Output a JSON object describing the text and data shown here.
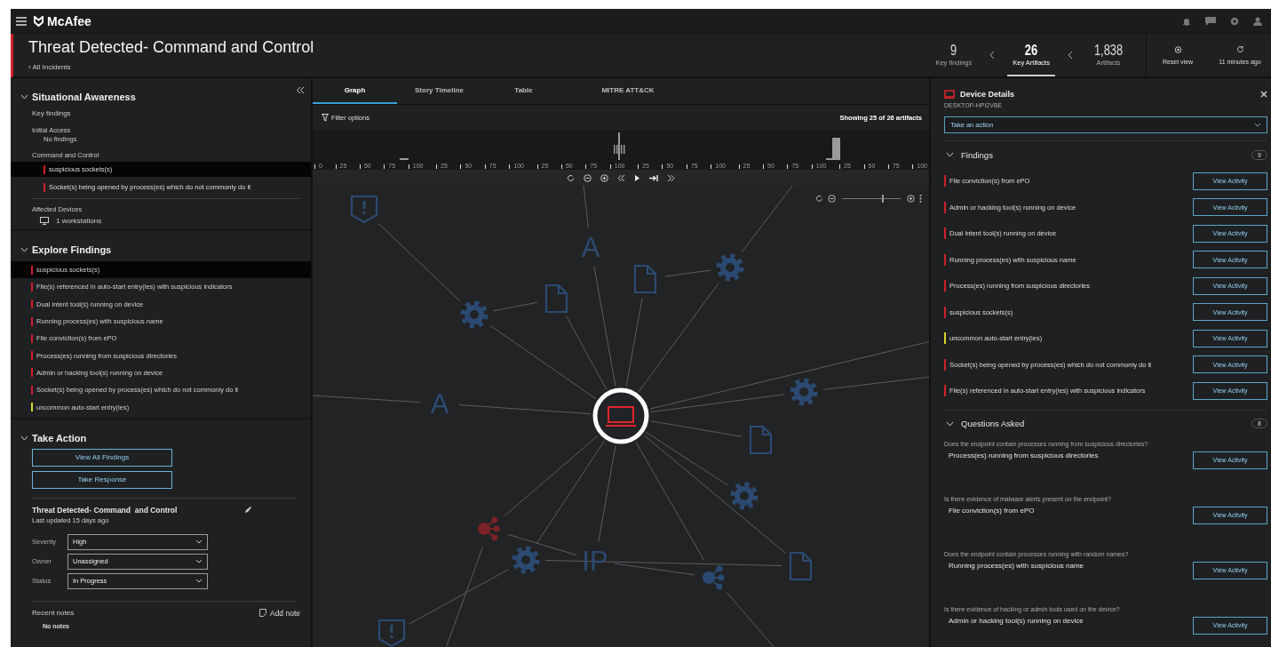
{
  "app": {
    "logo": "McAfee"
  },
  "incident": {
    "title": "Threat Detected- Command and Control",
    "back_link": "‹ All Incidents"
  },
  "stats": [
    {
      "value": "9",
      "label": "Key findings",
      "selected": false
    },
    {
      "value": "26",
      "label": "Key Artifacts",
      "selected": true
    },
    {
      "value": "1,838",
      "label": "Artifacts",
      "selected": false
    }
  ],
  "header_actions": [
    {
      "kind": "reset",
      "label": "Reset view"
    },
    {
      "kind": "refresh",
      "label": "11 minutes ago"
    }
  ],
  "situational_awareness": {
    "title": "Situational Awareness",
    "expanded": true,
    "key_findings": "Key findings",
    "groups": [
      {
        "name": "Initial Access",
        "note": "No findings"
      },
      {
        "name": "Command and Control",
        "items": [
          {
            "label": "suspicious sockets(s)",
            "color": "#d0202a",
            "selected": true
          },
          {
            "label": "Socket(s) being opened by process(es) which do not commonly do it",
            "color": "#d0202a",
            "selected": false
          }
        ]
      }
    ],
    "affected_devices": {
      "label": "Affected Devices",
      "value": "1 workstations"
    }
  },
  "explore_findings": {
    "title": "Explore Findings",
    "expanded": true,
    "items": [
      {
        "label": "suspicious sockets(s)",
        "color": "#d0202a",
        "selected": true
      },
      {
        "label": "File(s) referenced in auto-start entry(ies) with suspicious indicators",
        "color": "#d0202a",
        "selected": false
      },
      {
        "label": "Dual intent tool(s) running on device",
        "color": "#d0202a",
        "selected": false
      },
      {
        "label": "Running process(es) with suspicious name",
        "color": "#d0202a",
        "selected": false
      },
      {
        "label": "File conviction(s) from ePO",
        "color": "#d0202a",
        "selected": false
      },
      {
        "label": "Process(es) running from suspicious directories",
        "color": "#d0202a",
        "selected": false
      },
      {
        "label": "Admin or hacking tool(s) running on device",
        "color": "#d0202a",
        "selected": false
      },
      {
        "label": "Socket(s) being opened by process(es) which do not commonly do it",
        "color": "#d0202a",
        "selected": false
      },
      {
        "label": "uncommon auto-start entry(ies)",
        "color": "#d8d42a",
        "selected": false
      }
    ]
  },
  "take_action": {
    "title": "Take Action",
    "expanded": true,
    "buttons": [
      "View All Findings",
      "Take Response"
    ],
    "incident_title": "Threat Detected- Command  and Control",
    "updated": "Last updated 15 days ago",
    "fields": [
      {
        "label": "Severity",
        "value": "High"
      },
      {
        "label": "Owner",
        "value": "Unassigned"
      },
      {
        "label": "Status",
        "value": "In Progress"
      }
    ],
    "notes_label": "Recent notes",
    "add_note": "Add note",
    "notes_empty": "No notes"
  },
  "view_tabs": [
    {
      "label": "Graph",
      "selected": true
    },
    {
      "label": "Story Timeline",
      "selected": false
    },
    {
      "label": "Table",
      "selected": false
    },
    {
      "label": "MITRE ATT&CK",
      "selected": false
    }
  ],
  "filter": {
    "label": "Filter options",
    "summary": "Showing 25 of 26 artifacts"
  },
  "timeline": {
    "ticks": [
      "0",
      "25",
      "50",
      "75",
      "100",
      "25",
      "50",
      "75",
      "100",
      "25",
      "50",
      "75",
      "100",
      "25",
      "50",
      "75",
      "100",
      "25",
      "50",
      "75",
      "100",
      "25",
      "50",
      "75",
      "100"
    ]
  },
  "zoom": {
    "level": 0.7
  },
  "graph": {
    "nodes": [
      {
        "kind": "alert",
        "color": "#2b4a72"
      },
      {
        "kind": "letter",
        "label": "A",
        "color": "#2b4a72"
      },
      {
        "kind": "doc",
        "color": "#2b4a72"
      },
      {
        "kind": "gear",
        "color": "#2b4a72"
      },
      {
        "kind": "gear",
        "color": "#2b4a72"
      },
      {
        "kind": "doc",
        "color": "#2b4a72"
      },
      {
        "kind": "letter",
        "label": "A",
        "color": "#2b4a72"
      },
      {
        "kind": "gear",
        "color": "#2b4a72"
      },
      {
        "kind": "doc",
        "color": "#2b4a72"
      },
      {
        "kind": "gear",
        "color": "#2b4a72"
      },
      {
        "kind": "share",
        "color": "#7a2226"
      },
      {
        "kind": "gear",
        "color": "#2b4a72"
      },
      {
        "kind": "letter",
        "label": "IP",
        "color": "#2b4a72"
      },
      {
        "kind": "share",
        "color": "#2b4a72"
      },
      {
        "kind": "doc",
        "color": "#2b4a72"
      },
      {
        "kind": "alert",
        "color": "#2b4a72"
      }
    ]
  },
  "device_panel": {
    "title": "Device Details",
    "hostname": "DESKTOP-HPI2VBE",
    "action_prompt": "Take an action",
    "findings": {
      "title": "Findings",
      "count": "9",
      "expanded": true,
      "items": [
        {
          "label": "File conviction(s) from ePO",
          "color": "#d0202a",
          "button": "View Activity"
        },
        {
          "label": "Admin or hacking tool(s) running on device",
          "color": "#d0202a",
          "button": "View Activity"
        },
        {
          "label": "Dual intent tool(s) running on device",
          "color": "#d0202a",
          "button": "View Activity"
        },
        {
          "label": "Running process(es) with suspicious name",
          "color": "#d0202a",
          "button": "View Activity"
        },
        {
          "label": "Process(es) running from suspicious directories",
          "color": "#d0202a",
          "button": "View Activity"
        },
        {
          "label": "suspicious sockets(s)",
          "color": "#d0202a",
          "button": "View Activity"
        },
        {
          "label": "uncommon auto-start entry(ies)",
          "color": "#d8d42a",
          "button": "View Activity"
        },
        {
          "label": "Socket(s) being opened by process(es) which do not commonly do it",
          "color": "#d0202a",
          "button": "View Activity"
        },
        {
          "label": "File(s) referenced in auto-start entry(ies) with suspicious indicators",
          "color": "#d0202a",
          "button": "View Activity"
        }
      ]
    },
    "questions": {
      "title": "Questions Asked",
      "count": "8",
      "expanded": true,
      "items": [
        {
          "question": "Does the endpoint contain processes running from suspicious directories?",
          "answer": "Process(es) running from suspicious directories",
          "button": "View Activity"
        },
        {
          "question": "Is there evidence of malware alerts present on the endpoint?",
          "answer": "File conviction(s) from ePO",
          "button": "View Activity"
        },
        {
          "question": "Does the endpoint contain processes running with random names?",
          "answer": "Running process(es) with suspicious name",
          "button": "View Activity"
        },
        {
          "question": "Is there evidence of hacking or admin tools used on the device?",
          "answer": "Admin or hacking tool(s) running on device",
          "button": "View Activity"
        }
      ]
    }
  }
}
